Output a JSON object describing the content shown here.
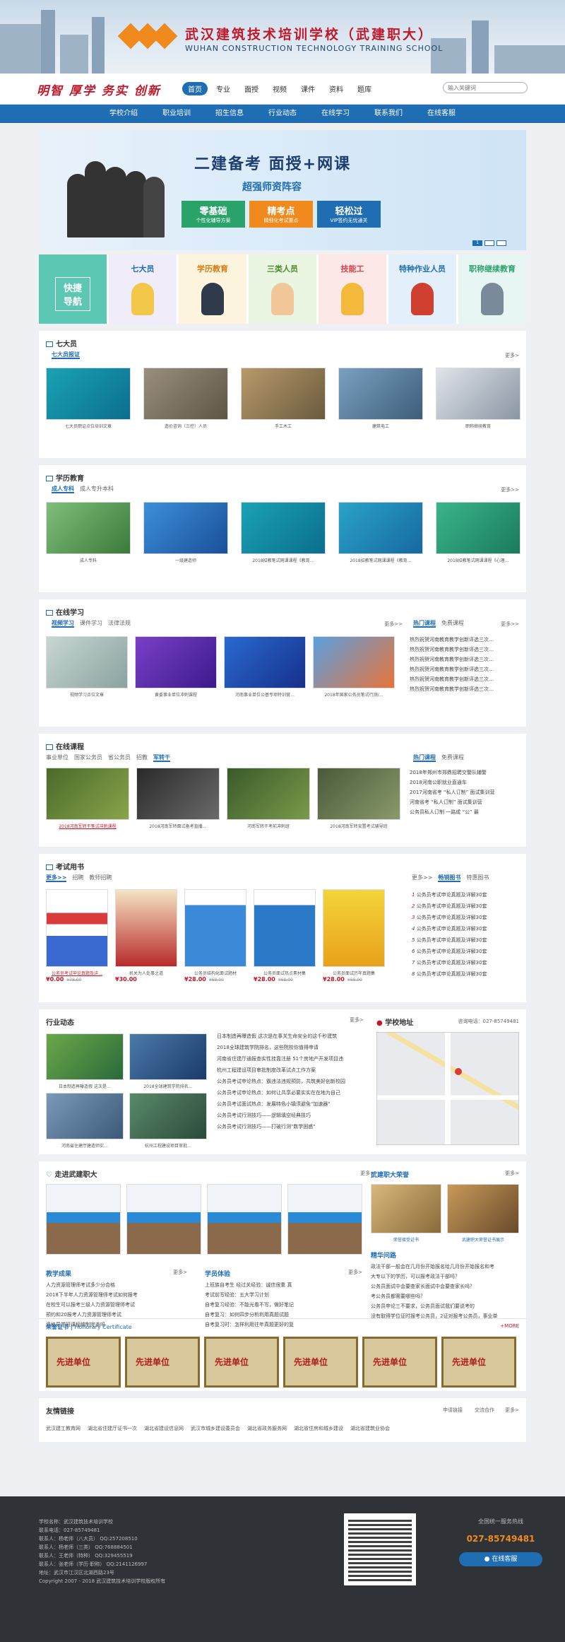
{
  "header": {
    "school_cn": "武汉建筑技术培训学校（武建职大）",
    "school_en": "WUHAN CONSTRUCTION TECHNOLOGY TRAINING SCHOOL",
    "slogan": "明智 厚学 务实 创新",
    "search_placeholder": "输入关键词"
  },
  "top_nav": [
    "首页",
    "专业",
    "面授",
    "视频",
    "课件",
    "资料",
    "题库"
  ],
  "main_nav": [
    "学校介绍",
    "职业培训",
    "招生信息",
    "行业动态",
    "在线学习",
    "联系我们",
    "在线客服"
  ],
  "banner": {
    "title": "二建备考  面授+网课",
    "subtitle": "超强师资阵容",
    "boxes": [
      {
        "t": "零基础",
        "s": "个性化辅导方案"
      },
      {
        "t": "精考点",
        "s": "精细化考试重点"
      },
      {
        "t": "轻松过",
        "s": "VIP签约无忧通关"
      }
    ],
    "dots": [
      "1",
      "2",
      "3"
    ]
  },
  "quick_nav": {
    "label": "快捷导航",
    "items": [
      "七大员",
      "学历教育",
      "三类人员",
      "技能工",
      "特种作业人员",
      "职称继续教育"
    ]
  },
  "qdy": {
    "title": "七大员",
    "tab": "七大员报证",
    "more": "更多>",
    "cards": [
      "七大员职证点位培训文章",
      "造价咨询（三控）人员",
      "手工木工",
      "建筑电工",
      "职称继续教育"
    ]
  },
  "xl": {
    "title": "学历教育",
    "tabs": [
      "成人专科",
      "成人专升本科"
    ],
    "more": "更多>>",
    "cards": [
      "成人专科",
      "一级建造师",
      "2018招教笔试网课课程《教育…",
      "2018招教笔试网课课程《教育…",
      "2018招教笔试网课课程《心理…"
    ]
  },
  "zx": {
    "title": "在线学习",
    "tabs": [
      "视频学习",
      "课件学习",
      "法律法规"
    ],
    "more": "更多>>",
    "tabs2": [
      "热门课程",
      "免费课程"
    ],
    "more2": "更多>>",
    "cards": [
      "视频学习点位文章",
      "黄委事业单位冲刺课程",
      "河南事业单位公基专项特训营…",
      "2018年国家公务员笔试行测/…"
    ],
    "list": [
      "热烈祝贺河南教育教学创新评选三次…",
      "热烈祝贺河南教育教学创新评选三次…",
      "热烈祝贺河南教育教学创新评选三次…",
      "热烈祝贺河南教育教学创新评选三次…",
      "热烈祝贺河南教育教学创新评选三次…",
      "热烈祝贺河南教育教学创新评选三次…"
    ]
  },
  "zxkc": {
    "title": "在线课程",
    "tabs": [
      "事业单位",
      "国家公务员",
      "省公务员",
      "招教",
      "军转干"
    ],
    "tabs2": [
      "热门课程",
      "免费课程"
    ],
    "cards": [
      "2018河南军转干笔试冲刺课程",
      "2018河南军转面试备考直播…",
      "河南军转干考前冲刺班",
      "2018河南军转安置考试辅导班"
    ],
    "list": [
      "2018年郑州市郑鼎招聘交警队辅警",
      "2018河南公职就业直通车",
      "2017河南省考 “私人订制” 面试集训营",
      "河南省考 “私人订制” 面试集训营",
      "公务员私人订制 一路成 “公” 最"
    ]
  },
  "ks": {
    "title": "考试用书",
    "tabs": [
      "更多>>",
      "招聘",
      "教师招聘"
    ],
    "more": "更多>>",
    "tabs2": [
      "畅销图书",
      "特惠图书"
    ],
    "books": [
      {
        "cap": "公务员考试申论真题及详…",
        "p": "¥0.00",
        "o": "¥78.00"
      },
      {
        "cap": "机关为人处事之道",
        "p": "¥30.00",
        "o": ""
      },
      {
        "cap": "公务员结构化面试题材",
        "p": "¥28.00",
        "o": "¥68.00"
      },
      {
        "cap": "公务员面试热点素材集",
        "p": "¥28.00",
        "o": "¥68.00"
      },
      {
        "cap": "公务员面试历年真题集",
        "p": "¥28.00",
        "o": "¥68.00"
      }
    ],
    "list": [
      "公务员考试申论真题及详解30套",
      "公务员考试申论真题及详解30套",
      "公务员考试申论真题及详解30套",
      "公务员考试申论真题及详解30套",
      "公务员考试申论真题及详解30套",
      "公务员考试申论真题及详解30套",
      "公务员考试申论真题及详解30套",
      "公务员考试申论真题及详解30套"
    ]
  },
  "hy": {
    "title": "行业动态",
    "more": "更多>",
    "thumbs": [
      "日本制造再曝造假 这次是…",
      "2018全球建筑学院排名…",
      "河南省住建厅建造师实…",
      "杭州工程建设项目审批…"
    ],
    "list": [
      "日本制造再曝造假 这次是在事关生命安全的这千秒建筑",
      "2018全球建筑学院排名，这些院校你值得申请",
      "河南省住建厅通报查实性挂靠注册 51个房地产开发项目违",
      "杭州工程建设项目审批制度改革试点工作方案",
      "公务员考试申论热点：霸违法违规预防，共筑美好创新校园",
      "公务员考试申论热点：如何让共享必要实实在在地为自己",
      "公务员考试面试热点：发展特色小镇须避免\"加速器\"",
      "公务员考试行测技巧——逻辑填空经典技巧",
      "公务员考试行测技巧——打破行测\"数学困惑\""
    ]
  },
  "school_addr": {
    "title": "学校地址",
    "tel": "咨询电话：027-85749481"
  },
  "zj": {
    "title": "走进武建职大",
    "more": "更多>",
    "right_title": "武建职大荣誉",
    "right_more": "更多>",
    "right_caps": [
      "荣誉接受证书",
      "武建职大荣誉证书展示"
    ],
    "sec_title": "精华问路",
    "sec_list": [
      "政法干部一般会在几月份开始报名给几月份开始报名和考",
      "大专以下的学历，可以报考政法干部吗？",
      "公务员面试中会要查家长面试中会要查家长吗？",
      "考公务员都需要哪些吗？",
      "公务员申论三不要求，公务员面试我们要说考的",
      "没有取得学位证时报考公务员，2证对报考公务员，事业单"
    ],
    "cases_title": "教学成果",
    "cases_more": "更多>",
    "cases": [
      "人力资源管理师考试多少分合格",
      "2018下半年人力资源管理师考试如何报考",
      "在校生可以报考三级人力资源管理师考试",
      "预约和20报考人力资源管理师考试",
      "资格导学班课程编制完善吗"
    ],
    "exp_title": "学员体验",
    "exp_more": "更多>",
    "exp": [
      "上班族自考生 经过关经验：诚信很重 真",
      "考试前写经验：五大学习计划",
      "自考复习经验：不能光看不写，做好笔记",
      "自考复习：如何四步分析利用真题试题",
      "自考复习时：怎样利用往年真题更好的复"
    ]
  },
  "honor": {
    "title": "荣誉证书",
    "sub": "Honorary Certificate",
    "more": "+MORE",
    "items": [
      "先进单位",
      "先进单位",
      "先进单位",
      "先进单位",
      "先进单位",
      "先进单位"
    ]
  },
  "links": {
    "title": "友情链接",
    "tabs": [
      "申请链接",
      "交流合作"
    ],
    "more": "更多>",
    "items": [
      "武汉建工教育网",
      "湖北省住建厅证书一次",
      "湖北省建设信息网",
      "武汉市城乡建设委员会",
      "湖北省政务服务网",
      "湖北省住房和城乡建设",
      "湖北省建筑业协会"
    ]
  },
  "footer": {
    "lines": [
      "学校名称：武汉建筑技术培训学校",
      "联系电话：027-85749481",
      "联系人：杨老师（八大员）  QQ:257208510",
      "联系人：杨老师（三类）  QQ:768884501",
      "联系人：王老师（特种）  QQ:329455519",
      "联系人：张老师（学历·职称）  QQ:2141126997",
      "地址：武汉市江汉区北湖西路23号",
      "Copyright 2007 - 2018 武汉建筑技术培训学校版权所有"
    ],
    "hotline_label": "全国统一服务热线",
    "hotline": "027-85749481",
    "cs_button": "在线客服"
  },
  "colors": {
    "brand_blue": "#1f6db3",
    "brand_red": "#c2182a",
    "orange": "#f08a1c"
  }
}
